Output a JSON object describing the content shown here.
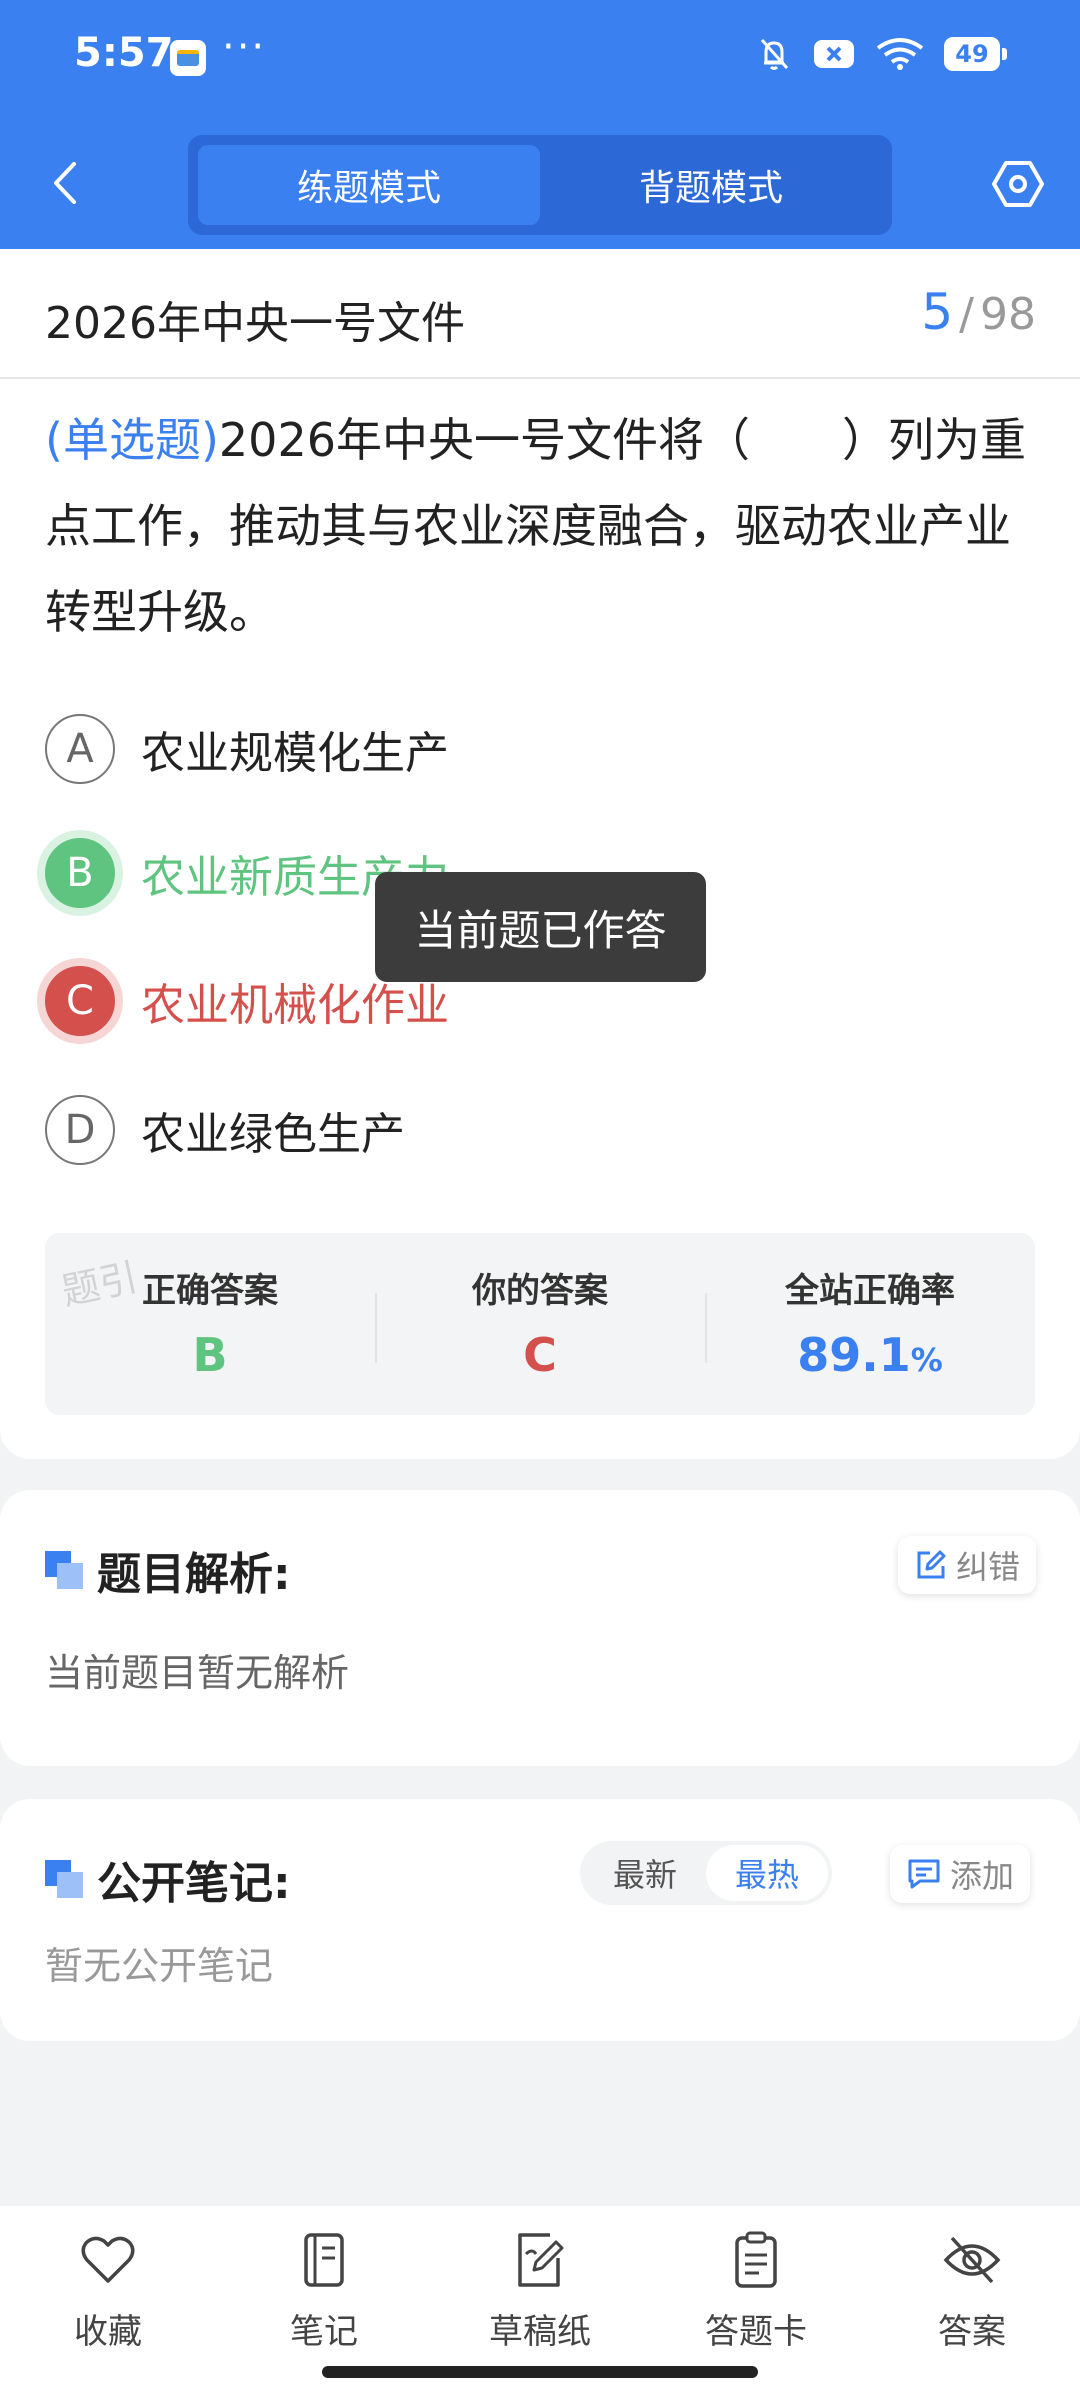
{
  "status_bar": {
    "time": "5:57",
    "more": "···",
    "battery": "49"
  },
  "header": {
    "tabs": [
      {
        "label": "练题模式",
        "active": true
      },
      {
        "label": "背题模式",
        "active": false
      }
    ],
    "accent_color": "#3b80f0"
  },
  "question": {
    "title": "2026年中央一号文件",
    "current": "5",
    "separator": "/",
    "total": "98",
    "type": "(单选题)",
    "text": "2026年中央一号文件将（　　）列为重点工作，推动其与农业深度融合，驱动农业产业转型升级。",
    "options": [
      {
        "letter": "A",
        "text": "农业规模化生产",
        "state": "normal"
      },
      {
        "letter": "B",
        "text": "农业新质生产力",
        "state": "correct"
      },
      {
        "letter": "C",
        "text": "农业机械化作业",
        "state": "wrong"
      },
      {
        "letter": "D",
        "text": "农业绿色生产",
        "state": "normal"
      }
    ],
    "toast": "当前题已作答",
    "watermark": "题引"
  },
  "result": {
    "correct_label": "正确答案",
    "correct_value": "B",
    "yours_label": "你的答案",
    "yours_value": "C",
    "rate_label": "全站正确率",
    "rate_value": "89.1",
    "rate_unit": "%"
  },
  "analysis": {
    "title": "题目解析:",
    "report_label": "纠错",
    "body": "当前题目暂无解析"
  },
  "notes": {
    "title": "公开笔记:",
    "sort_options": [
      "最新",
      "最热"
    ],
    "active_sort": "最热",
    "add_label": "添加",
    "body": "暂无公开笔记"
  },
  "bottom_bar": [
    {
      "label": "收藏",
      "icon": "heart-icon"
    },
    {
      "label": "笔记",
      "icon": "notebook-icon"
    },
    {
      "label": "草稿纸",
      "icon": "draft-paper-icon"
    },
    {
      "label": "答题卡",
      "icon": "answer-sheet-icon"
    },
    {
      "label": "答案",
      "icon": "eye-off-icon"
    }
  ],
  "colors": {
    "correct": "#5ec47f",
    "wrong": "#d4504c",
    "primary": "#3b80f0"
  }
}
